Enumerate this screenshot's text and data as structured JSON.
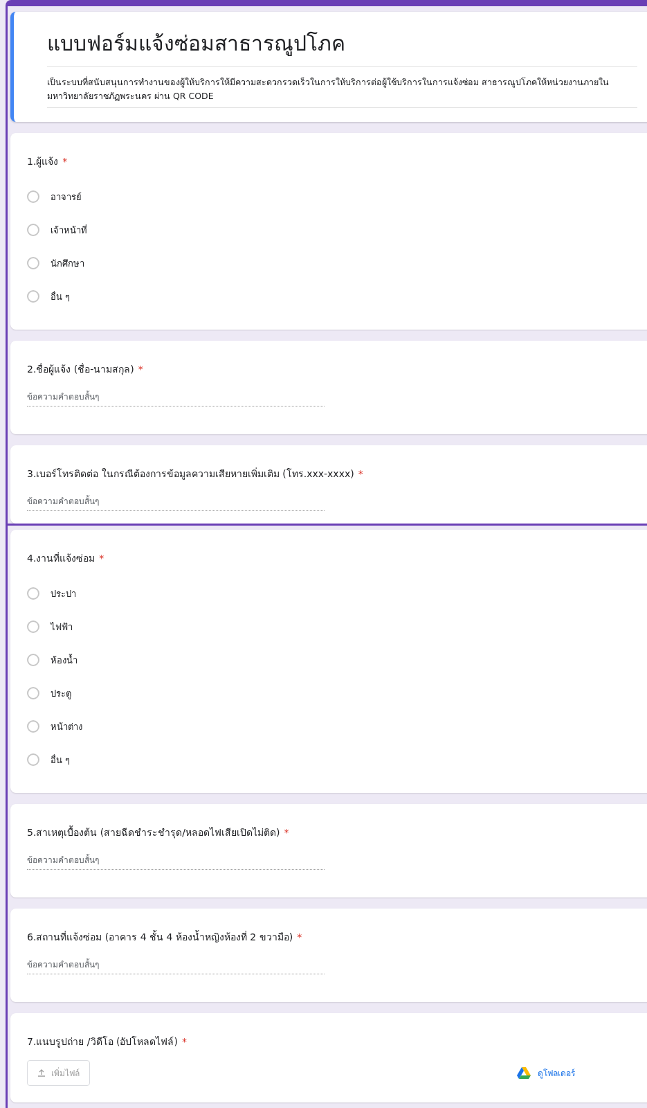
{
  "header": {
    "title": "แบบฟอร์มแจ้งซ่อมสาธารณูปโภค",
    "description": "เป็นระบบที่สนับสนุนการทำงานของผู้ให้บริการให้มีความสะดวกรวดเร็วในการให้บริการต่อผู้ใช้บริการในการแจ้งซ่อม สาธารณูปโภคให้หน่วยงานภายในมหาวิทยาลัยราชภัฏพระนคร ผ่าน QR CODE"
  },
  "sections": [
    {
      "questions": [
        {
          "kind": "radio",
          "label": "1.ผู้แจ้ง",
          "required_mark": "*",
          "options": [
            {
              "label": "อาจารย์",
              "selected": false
            },
            {
              "label": "เจ้าหน้าที่",
              "selected": false
            },
            {
              "label": "นักศึกษา",
              "selected": false
            },
            {
              "label": "อื่น ๆ",
              "selected": false
            }
          ]
        },
        {
          "kind": "text",
          "label": "2.ชื่อผู้แจ้ง (ชื่อ-นามสกุล)",
          "required_mark": "*",
          "placeholder": "ข้อความคำตอบสั้นๆ"
        },
        {
          "kind": "text",
          "label": "3.เบอร์โทรติดต่อ ในกรณีต้องการข้อมูลความเสียหายเพิ่มเติม  (โทร.xxx-xxxx)",
          "required_mark": "*",
          "placeholder": "ข้อความคำตอบสั้นๆ"
        }
      ]
    },
    {
      "questions": [
        {
          "kind": "radio",
          "label": "4.งานที่แจ้งซ่อม",
          "required_mark": "*",
          "options": [
            {
              "label": "ประปา",
              "selected": false
            },
            {
              "label": "ไฟฟ้า",
              "selected": false
            },
            {
              "label": "ห้องน้ำ",
              "selected": false
            },
            {
              "label": "ประตู",
              "selected": false
            },
            {
              "label": "หน้าต่าง",
              "selected": false
            },
            {
              "label": "อื่น ๆ",
              "selected": false
            }
          ]
        },
        {
          "kind": "text",
          "label": "5.สาเหตุเบื้องต้น (สายฉีดชำระชำรุด/หลอดไฟเสียเปิดไม่ติด)",
          "required_mark": "*",
          "placeholder": "ข้อความคำตอบสั้นๆ"
        },
        {
          "kind": "text",
          "label": "6.สถานที่แจ้งซ่อม (อาคาร 4 ชั้น 4 ห้องน้ำหญิงห้องที่ 2 ขวามือ)",
          "required_mark": "*",
          "placeholder": "ข้อความคำตอบสั้นๆ"
        },
        {
          "kind": "file",
          "label": "7.แนบรูปถ่าย /วิดีโอ (อัปโหลดไฟล์)",
          "required_mark": "*",
          "button": "เพิ่มไฟล์",
          "link": "ดูโฟลเดอร์"
        }
      ]
    }
  ]
}
